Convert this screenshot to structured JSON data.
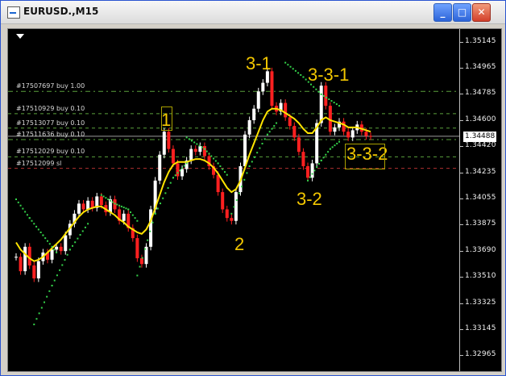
{
  "window": {
    "title": "EURUSD.,M15",
    "buttons": {
      "minimize": "_",
      "maximize": "□",
      "close": "✕"
    }
  },
  "chart_data": {
    "type": "line",
    "symbol": "EURUSD.",
    "timeframe": "M15",
    "ylim": [
      1.329,
      1.352
    ],
    "y_ticks": [
      "1.35145",
      "1.34965",
      "1.34785",
      "1.34600",
      "1.34420",
      "1.34235",
      "1.34055",
      "1.33875",
      "1.33690",
      "1.33510",
      "1.33325",
      "1.33145",
      "1.32965"
    ],
    "current_price": "1.34488",
    "current_price_value": 1.34488,
    "grid": false,
    "price_series": [
      1.3365,
      1.3355,
      1.3372,
      1.3359,
      1.335,
      1.3362,
      1.3368,
      1.3363,
      1.337,
      1.3372,
      1.3369,
      1.338,
      1.3388,
      1.3395,
      1.3402,
      1.3398,
      1.3404,
      1.3399,
      1.3407,
      1.3401,
      1.3396,
      1.3405,
      1.3398,
      1.339,
      1.3395,
      1.3385,
      1.3378,
      1.3364,
      1.336,
      1.3372,
      1.3398,
      1.3418,
      1.3436,
      1.3452,
      1.344,
      1.343,
      1.3421,
      1.3426,
      1.3432,
      1.344,
      1.3438,
      1.3442,
      1.3435,
      1.3428,
      1.3422,
      1.341,
      1.3398,
      1.3392,
      1.339,
      1.341,
      1.3428,
      1.345,
      1.346,
      1.3468,
      1.348,
      1.3486,
      1.3494,
      1.347,
      1.3466,
      1.3472,
      1.3462,
      1.3456,
      1.3448,
      1.3438,
      1.3428,
      1.342,
      1.343,
      1.3458,
      1.3484,
      1.347,
      1.3452,
      1.3455,
      1.3459,
      1.3452,
      1.3448,
      1.3453,
      1.3457,
      1.3452,
      1.3449,
      1.34488
    ],
    "moving_average": [
      1.3375,
      1.337,
      1.3367,
      1.3364,
      1.3362,
      1.3363,
      1.3365,
      1.3368,
      1.3371,
      1.3374,
      1.3377,
      1.3381,
      1.3385,
      1.3389,
      1.3393,
      1.3396,
      1.3398,
      1.3399,
      1.34,
      1.34,
      1.3398,
      1.3396,
      1.3394,
      1.3391,
      1.3389,
      1.3386,
      1.3384,
      1.3382,
      1.3381,
      1.3384,
      1.339,
      1.3399,
      1.3408,
      1.3417,
      1.3424,
      1.3429,
      1.3431,
      1.3431,
      1.3431,
      1.3432,
      1.3433,
      1.3433,
      1.3432,
      1.343,
      1.3427,
      1.3423,
      1.3418,
      1.3413,
      1.341,
      1.3412,
      1.3418,
      1.3427,
      1.3436,
      1.3444,
      1.3452,
      1.346,
      1.3466,
      1.3468,
      1.3468,
      1.3467,
      1.3465,
      1.3463,
      1.3461,
      1.3458,
      1.3454,
      1.3451,
      1.3451,
      1.3455,
      1.346,
      1.3462,
      1.346,
      1.3459,
      1.3458,
      1.3457,
      1.3455,
      1.3455,
      1.3455,
      1.3454,
      1.3453,
      1.3452
    ],
    "sar_segments": [
      {
        "label": "sar-seg-1",
        "points": [
          [
            0,
            1.3405
          ],
          [
            3,
            1.3392
          ],
          [
            6,
            1.338
          ],
          [
            9,
            1.3368
          ]
        ]
      },
      {
        "label": "sar-seg-2",
        "points": [
          [
            4,
            1.3318
          ],
          [
            8,
            1.3345
          ],
          [
            12,
            1.337
          ],
          [
            16,
            1.3388
          ]
        ]
      },
      {
        "label": "sar-seg-3",
        "points": [
          [
            19,
            1.3408
          ],
          [
            22,
            1.3402
          ],
          [
            25,
            1.3398
          ],
          [
            27,
            1.339
          ]
        ]
      },
      {
        "label": "sar-seg-4",
        "points": [
          [
            27,
            1.3352
          ],
          [
            31,
            1.3395
          ],
          [
            35,
            1.342
          ],
          [
            38,
            1.343
          ]
        ]
      },
      {
        "label": "sar-seg-5",
        "points": [
          [
            38,
            1.3448
          ],
          [
            42,
            1.344
          ],
          [
            45,
            1.343
          ],
          [
            47,
            1.3422
          ]
        ]
      },
      {
        "label": "sar-seg-6",
        "points": [
          [
            48,
            1.3395
          ],
          [
            52,
            1.3428
          ],
          [
            56,
            1.345
          ],
          [
            58,
            1.3458
          ]
        ]
      },
      {
        "label": "sar-seg-7",
        "points": [
          [
            60,
            1.35
          ],
          [
            64,
            1.349
          ],
          [
            68,
            1.3478
          ],
          [
            72,
            1.347
          ]
        ]
      },
      {
        "label": "sar-seg-8",
        "points": [
          [
            65,
            1.3418
          ],
          [
            68,
            1.3432
          ],
          [
            70,
            1.344
          ],
          [
            72,
            1.3445
          ]
        ]
      }
    ],
    "order_lines": [
      {
        "label": "#17507697 buy 1.00",
        "price": 1.348,
        "color": "#5aa03c",
        "dash": "6,4,2,4"
      },
      {
        "label": "#17510929 buy 0.10",
        "price": 1.34645,
        "color": "#5aa03c",
        "dash": "4,4"
      },
      {
        "label": "#17513077 buy 0.10",
        "price": 1.34545,
        "color": "#5aa03c",
        "dash": "4,4"
      },
      {
        "label": "#17511636 buy 0.10",
        "price": 1.34465,
        "color": "#5aa03c",
        "dash": "6,4,2,4"
      },
      {
        "label": "#17512029 buy 0.10",
        "price": 1.34345,
        "color": "#5aa03c",
        "dash": "4,4"
      },
      {
        "label": "#17512099 sl",
        "price": 1.34265,
        "color": "#b03030",
        "dash": "4,4"
      }
    ],
    "annotations": [
      {
        "text": "1"
      },
      {
        "text": "2"
      },
      {
        "text": "3-1"
      },
      {
        "text": "3-2"
      },
      {
        "text": "3-3-1"
      },
      {
        "text": "3-3-2"
      }
    ],
    "colors": {
      "background": "#000000",
      "bull_candle": "#ffffff",
      "bear_candle": "#ff2020",
      "moving_average": "#ffe400",
      "sar": "#34d24a",
      "annotation": "#f3c700"
    }
  }
}
